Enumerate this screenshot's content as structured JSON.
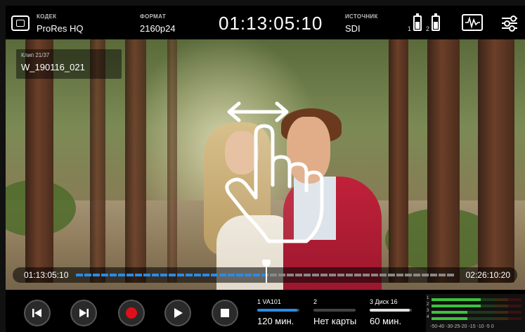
{
  "topbar": {
    "codec_label": "КОДЕК",
    "codec_value": "ProRes HQ",
    "format_label": "ФОРМАТ",
    "format_value": "2160p24",
    "timecode": "01:13:05:10",
    "source_label": "ИСТОЧНИК",
    "source_value": "SDI",
    "battery_1": "1",
    "battery_2": "2"
  },
  "clip": {
    "number": "Клип 21/37",
    "name": "W_190116_021"
  },
  "scrubber": {
    "current_timecode": "01:13:05:10",
    "duration_timecode": "02:26:10:20",
    "progress": 0.5
  },
  "media_slots": [
    {
      "label": "1  VA101",
      "value": "120 мин.",
      "fill_color": "#2b8be6",
      "fill": 0.95
    },
    {
      "label": "2",
      "value": "Нет карты",
      "fill_color": "#444444",
      "fill": 0
    },
    {
      "label": "3 Диск 16",
      "value": "60 мин.",
      "fill_color": "#e0e0e0",
      "fill": 0.95
    }
  ],
  "audio_meter": {
    "channel_labels": [
      "1",
      "2",
      "3",
      "4"
    ],
    "scale": "-50-40  -30-25-20  -15  -10   -5    0"
  },
  "colors": {
    "accent_blue": "#2b8be6",
    "record_red": "#e0101a",
    "meter_green": "#3dc23d"
  },
  "icons": [
    "fullscreen-icon",
    "battery-icon",
    "waveform-icon",
    "settings-sliders-icon",
    "skip-back-icon",
    "skip-forward-icon",
    "record-icon",
    "play-icon",
    "stop-icon",
    "pinch-swipe-gesture-icon"
  ]
}
